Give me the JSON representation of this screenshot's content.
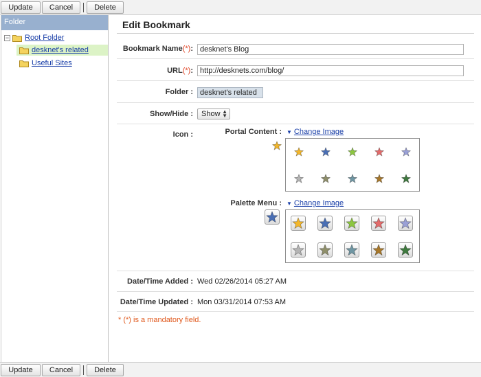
{
  "toolbar": {
    "update": "Update",
    "cancel": "Cancel",
    "delete": "Delete"
  },
  "sidebar": {
    "header": "Folder",
    "tree": [
      {
        "label": "Root Folder",
        "level": 0,
        "selected": false
      },
      {
        "label": "desknet's related",
        "level": 1,
        "selected": true
      },
      {
        "label": "Useful Sites",
        "level": 1,
        "selected": false
      }
    ]
  },
  "form": {
    "title": "Edit Bookmark",
    "name_label": "Bookmark Name",
    "url_label": "URL",
    "required_mark": "(*)",
    "colon": ":",
    "name_value": "desknet's Blog",
    "url_value": "http://desknets.com/blog/",
    "folder_label": "Folder :",
    "folder_value": "desknet's related",
    "show_label": "Show/Hide :",
    "show_value": "Show",
    "icon_label": "Icon :",
    "portal_label": "Portal Content :",
    "palette_label": "Palette Menu :",
    "change_image": "Change Image",
    "added_label": "Date/Time Added :",
    "added_value": "Wed 02/26/2014 05:27 AM",
    "updated_label": "Date/Time Updated :",
    "updated_value": "Mon 03/31/2014 07:53 AM",
    "mandatory_note": "* (*) is a mandatory field."
  },
  "colors": {
    "star_colors": [
      "#f2b62b",
      "#4a6fb5",
      "#8cc640",
      "#e26b6b",
      "#9aa0d6",
      "#b4b4b4",
      "#8f8f6a",
      "#6f96a3",
      "#a8782a",
      "#3f7a3f"
    ],
    "portal_selected": "#f2b62b",
    "palette_selected": "#4a6fb5"
  }
}
